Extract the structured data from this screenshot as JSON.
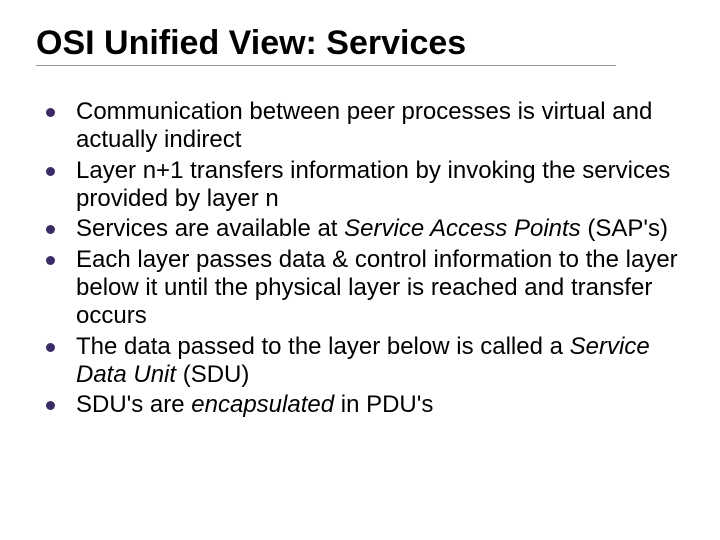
{
  "title": "OSI Unified View: Services",
  "bullets": [
    {
      "pre": "Communication between peer processes is virtual and actually indirect",
      "em": "",
      "post": ""
    },
    {
      "pre": "Layer n+1 transfers information by invoking the services provided by layer n",
      "em": "",
      "post": ""
    },
    {
      "pre": "Services are available at ",
      "em": "Service Access Points",
      "post": " (SAP's)"
    },
    {
      "pre": "Each layer passes data & control information to the layer below it until the physical layer is reached and transfer occurs",
      "em": "",
      "post": ""
    },
    {
      "pre": "The data passed to the layer below is called a ",
      "em": "Service Data Unit",
      "post": " (SDU)"
    },
    {
      "pre": "SDU's are ",
      "em": "encapsulated",
      "post": " in PDU's"
    }
  ],
  "bullet_color": "#3b2a66"
}
